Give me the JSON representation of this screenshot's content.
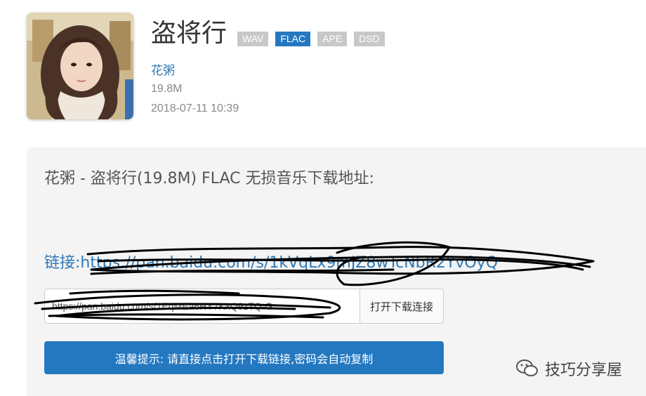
{
  "song": {
    "title": "盗将行",
    "artist": "花粥",
    "size": "19.8M",
    "date": "2018-07-11 10:39",
    "formats": [
      {
        "label": "WAV",
        "active": false
      },
      {
        "label": "FLAC",
        "active": true
      },
      {
        "label": "APE",
        "active": false
      },
      {
        "label": "DSD",
        "active": false
      }
    ]
  },
  "download": {
    "heading": "花粥 - 盗将行(19.8M) FLAC 无损音乐下载地址:",
    "link_label": "链接:",
    "link_url": "https://pan.baidu.com/s/1kVqLx9mJZ8wTcNbR2YvOyQ",
    "code_value": "https://pan.baidu.com/s/1EqMEa6HY7KxQ9zTQ-G",
    "open_button": "打开下载连接",
    "tip": "温馨提示: 请直接点击打开下载链接,密码会自动复制"
  },
  "watermark": {
    "text": "技巧分享屋"
  },
  "colors": {
    "accent": "#2478c0",
    "link": "#2f79b7",
    "tag_inactive": "#c8c8c8"
  }
}
